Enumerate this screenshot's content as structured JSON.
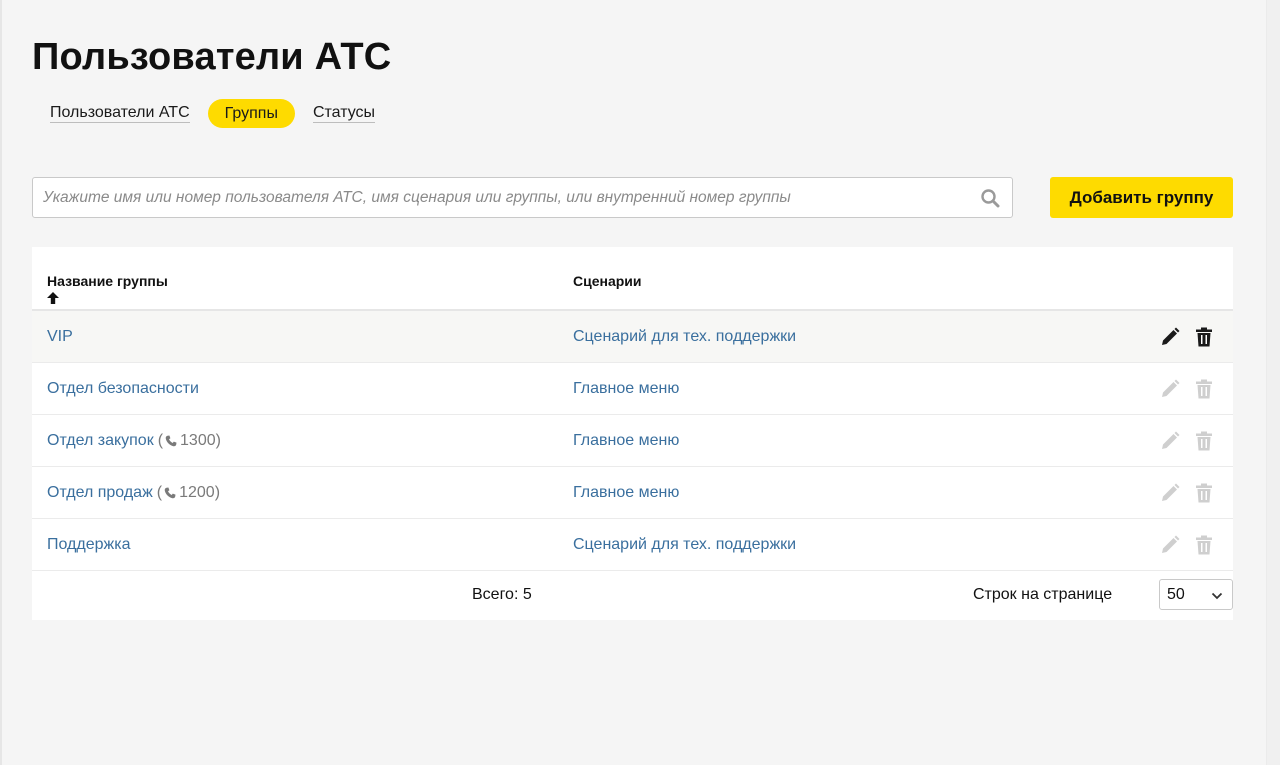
{
  "page": {
    "title": "Пользователи АТС"
  },
  "tabs": [
    {
      "label": "Пользователи АТС",
      "active": false
    },
    {
      "label": "Группы",
      "active": true
    },
    {
      "label": "Статусы",
      "active": false
    }
  ],
  "search": {
    "placeholder": "Укажите имя или номер пользователя АТС, имя сценария или группы, или внутренний номер группы",
    "value": "",
    "icon": "search-icon"
  },
  "add_button": {
    "label": "Добавить группу"
  },
  "table": {
    "columns": {
      "name": "Название группы",
      "scenarios": "Сценарии"
    },
    "sort": {
      "column": "name",
      "direction": "ascending",
      "icon": "arrow-up-icon"
    },
    "rows": [
      {
        "name": "VIP",
        "ext_prefix": "",
        "extension": "",
        "ext_suffix": "",
        "scenario": "Сценарий для тех. поддержки"
      },
      {
        "name": "Отдел безопасности",
        "ext_prefix": "",
        "extension": "",
        "ext_suffix": "",
        "scenario": "Главное меню"
      },
      {
        "name": "Отдел закупок",
        "ext_prefix": "(",
        "extension": "1300",
        "ext_suffix": ")",
        "scenario": "Главное меню"
      },
      {
        "name": "Отдел продаж",
        "ext_prefix": "(",
        "extension": "1200",
        "ext_suffix": ")",
        "scenario": "Главное меню"
      },
      {
        "name": "Поддержка",
        "ext_prefix": "",
        "extension": "",
        "ext_suffix": "",
        "scenario": "Сценарий для тех. поддержки"
      }
    ],
    "row_actions": {
      "edit_icon": "pencil-icon",
      "delete_icon": "trash-icon"
    }
  },
  "footer": {
    "total": "Всего: 5",
    "rows_per_page_label": "Строк на странице",
    "rows_per_page_value": "50"
  },
  "colors": {
    "accent": "#fedb00",
    "link": "#3a6f9e",
    "icon_active": "#1a1a1a",
    "icon_inactive": "#cfcfcf"
  }
}
